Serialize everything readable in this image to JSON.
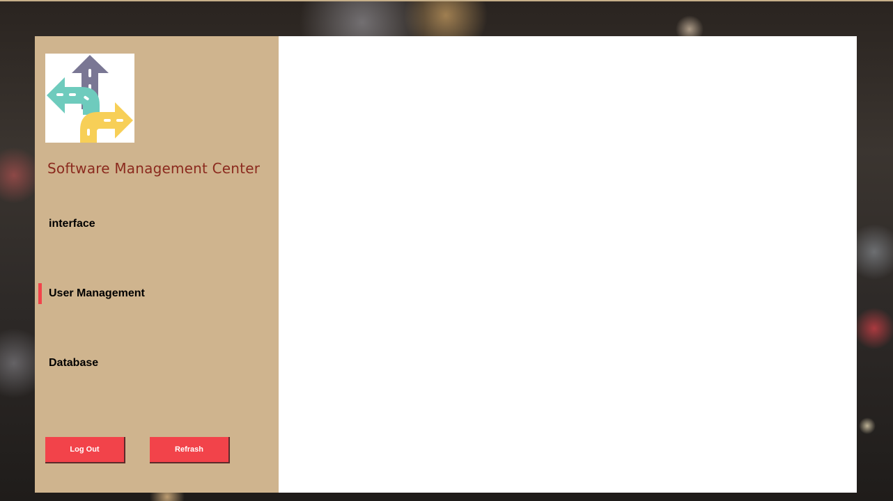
{
  "app": {
    "title": "Software Management Center",
    "logo_icon": "road-direction-arrows-icon"
  },
  "sidebar": {
    "items": [
      {
        "label": "interface",
        "active": false
      },
      {
        "label": "User Management",
        "active": true
      },
      {
        "label": "Database",
        "active": false
      }
    ]
  },
  "buttons": {
    "logout_label": "Log Out",
    "refresh_label": "Refrash"
  },
  "colors": {
    "sidebar_bg": "#cfb48e",
    "title_color": "#8b2a1e",
    "accent": "#f2434a",
    "content_bg": "#ffffff"
  }
}
